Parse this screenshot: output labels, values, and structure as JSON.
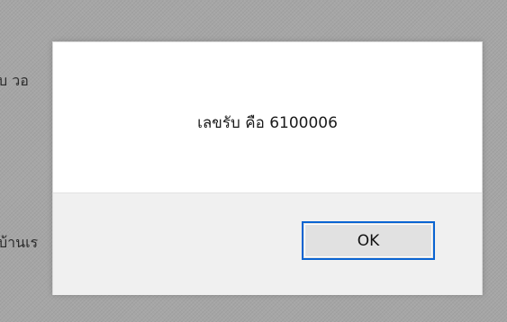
{
  "background": {
    "text_left_top": "บ วอ",
    "text_left_bottom": "บ้านเร",
    "text_right_bottom": "ี่"
  },
  "dialog": {
    "message": "เลขรับ คือ 6100006",
    "ok_label": "OK"
  },
  "colors": {
    "accent": "#0a64d2",
    "overlay": "#a6a6a6",
    "footer": "#f0f0f0"
  }
}
